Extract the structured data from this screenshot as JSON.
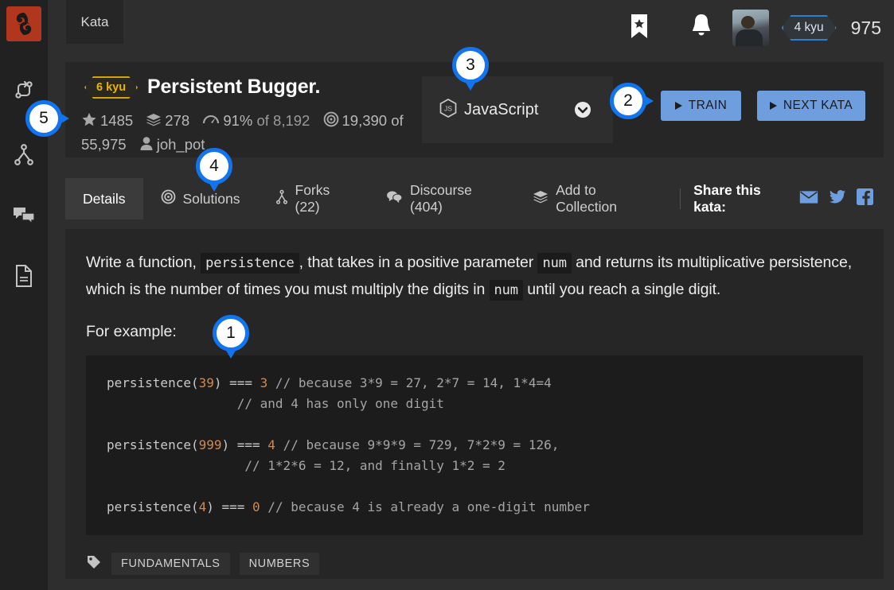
{
  "sidebar": {
    "logo_name": "codewars-logo",
    "items": [
      {
        "name": "compare-icon"
      },
      {
        "name": "fork-icon"
      },
      {
        "name": "discussion-icon"
      },
      {
        "name": "document-icon"
      }
    ]
  },
  "header": {
    "tab_label": "Kata",
    "bookmark_icon": "bookmark-icon",
    "bell_icon": "bell-icon",
    "avatar": "user-avatar",
    "user_rank": "4 kyu",
    "honor": "975"
  },
  "kata": {
    "rank": "6 kyu",
    "title": "Persistent Bugger.",
    "stars": "1485",
    "collections": "278",
    "satisfaction": "91%",
    "satisfaction_of": "of 8,192",
    "completed": "19,390 of",
    "completed_total": "55,975",
    "author": "joh_pot",
    "language": "JavaScript",
    "train_label": "TRAIN",
    "next_label": "NEXT KATA"
  },
  "tabs": [
    {
      "label": "Details",
      "icon": "",
      "active": true
    },
    {
      "label": "Solutions",
      "icon": "target-icon",
      "active": false
    },
    {
      "label": "Forks (22)",
      "icon": "fork-icon",
      "active": false
    },
    {
      "label": "Discourse (404)",
      "icon": "chat-icon",
      "active": false
    }
  ],
  "collection": {
    "label": "Add to Collection",
    "icon": "stack-icon"
  },
  "share": {
    "label": "Share this kata:",
    "icons": [
      "email-icon",
      "twitter-icon",
      "facebook-icon"
    ]
  },
  "description": {
    "line1_a": "Write a function, ",
    "code1": "persistence",
    "line1_b": ", that takes in a positive parameter ",
    "code2": "num",
    "line1_c": " and returns its multiplicative persistence, which is the number of times you must multiply the digits in ",
    "code3": "num",
    "line1_d": " until you reach a single digit.",
    "example_label": "For example:"
  },
  "code_example": {
    "lines": [
      {
        "plain1": "persistence(",
        "num1": "39",
        "plain2": ") === ",
        "num2": "3",
        "comment": " // because 3*9 = 27, 2*7 = 14, 1*4=4"
      },
      {
        "plain1": "",
        "num1": "",
        "plain2": "",
        "num2": "",
        "comment": "                 // and 4 has only one digit"
      },
      {
        "plain1": "",
        "num1": "",
        "plain2": "",
        "num2": "",
        "comment": ""
      },
      {
        "plain1": "persistence(",
        "num1": "999",
        "plain2": ") === ",
        "num2": "4",
        "comment": " // because 9*9*9 = 729, 7*2*9 = 126,"
      },
      {
        "plain1": "",
        "num1": "",
        "plain2": "",
        "num2": "",
        "comment": "                  // 1*2*6 = 12, and finally 1*2 = 2"
      },
      {
        "plain1": "",
        "num1": "",
        "plain2": "",
        "num2": "",
        "comment": ""
      },
      {
        "plain1": "persistence(",
        "num1": "4",
        "plain2": ") === ",
        "num2": "0",
        "comment": " // because 4 is already a one-digit number"
      }
    ]
  },
  "tags": {
    "icon": "tag-icon",
    "items": [
      "FUNDAMENTALS",
      "NUMBERS"
    ]
  },
  "markers": [
    {
      "id": "1",
      "number": "1",
      "direction": "down"
    },
    {
      "id": "2",
      "number": "2",
      "direction": "right"
    },
    {
      "id": "3",
      "number": "3",
      "direction": "down"
    },
    {
      "id": "4",
      "number": "4",
      "direction": "down"
    },
    {
      "id": "5",
      "number": "5",
      "direction": "right"
    }
  ],
  "colors": {
    "accent_blue": "#6f9ede",
    "marker_blue": "#1275ef",
    "rank_yellow": "#d4a407",
    "user_rank_blue": "#2b7fd4",
    "code_number": "#cd8a55",
    "logo_red": "#b1361e"
  }
}
